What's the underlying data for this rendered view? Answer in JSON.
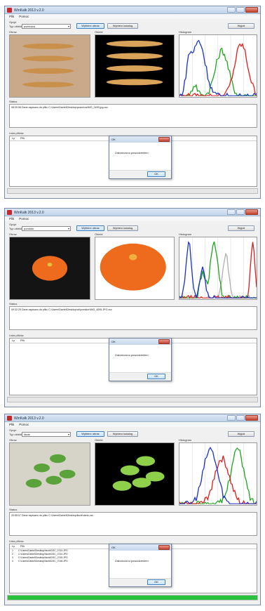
{
  "app": {
    "title": "WinKalk 2013 v.2.0",
    "menu": [
      "Plik",
      "Pomoc"
    ],
    "options_label": "Opcje",
    "object_type_label": "Typ obiektu:",
    "choose_image_label": "Wybierz obraz",
    "choose_folder_label": "Wybierz katalog",
    "save_label": "Wyjdź",
    "image_label": "Obraz",
    "object_label": "Obiekt",
    "histogram_label": "Histogram",
    "status_label": "Status",
    "files_label": "Lista plików",
    "col_lp": "Lp",
    "col_file": "Plik"
  },
  "dialog": {
    "title": "OK",
    "message": "Zakończono powodzeniem",
    "ok_label": "OK"
  },
  "windows": [
    {
      "object_type": "pszenica",
      "status_text": "08:30:56 Dane zapisano do pliku C:\\Users\\Daniel\\Desktop\\pszenica\\IMG_0499.jpg.csv",
      "files": [],
      "progress": 0,
      "colors": {
        "image_bg": "#c9a98a",
        "object_bg": "#000000",
        "object_fg": "#d9a35a"
      }
    },
    {
      "object_type": "pomidor",
      "status_text": "09:32:25 Dane zapisano do pliku C:\\Users\\Daniel\\Desktop\\c#\\pomidor\\IMG_4095.JPG.csv",
      "files": [],
      "progress": 0,
      "colors": {
        "image_bg": "#141414",
        "object_bg": "#ffffff",
        "object_fg": "#ee6a1c"
      }
    },
    {
      "object_type": "liście",
      "status_text": "20:55:07 Dane zapisano do pliku C:\\Users\\Daniel\\Desktop\\liscie\\dane.csv",
      "files": [
        {
          "lp": "1",
          "file": "C:\\Users\\Daniel\\Desktop\\liscie\\DSC_0743.JPG"
        },
        {
          "lp": "2",
          "file": "C:\\Users\\Daniel\\Desktop\\liscie\\DSC_0744.JPG"
        },
        {
          "lp": "3",
          "file": "C:\\Users\\Daniel\\Desktop\\liscie\\DSC_0745.JPG"
        },
        {
          "lp": "4",
          "file": "C:\\Users\\Daniel\\Desktop\\liscie\\DSC_0746.JPG"
        }
      ],
      "progress": 100,
      "colors": {
        "image_bg": "#d6d3c8",
        "object_bg": "#000000",
        "object_fg": "#8fd04a"
      }
    }
  ],
  "histogram_colors": {
    "red": "#e31b1b",
    "green": "#1ea51e",
    "blue": "#1a33c8",
    "gray": "#b0b0b0"
  }
}
